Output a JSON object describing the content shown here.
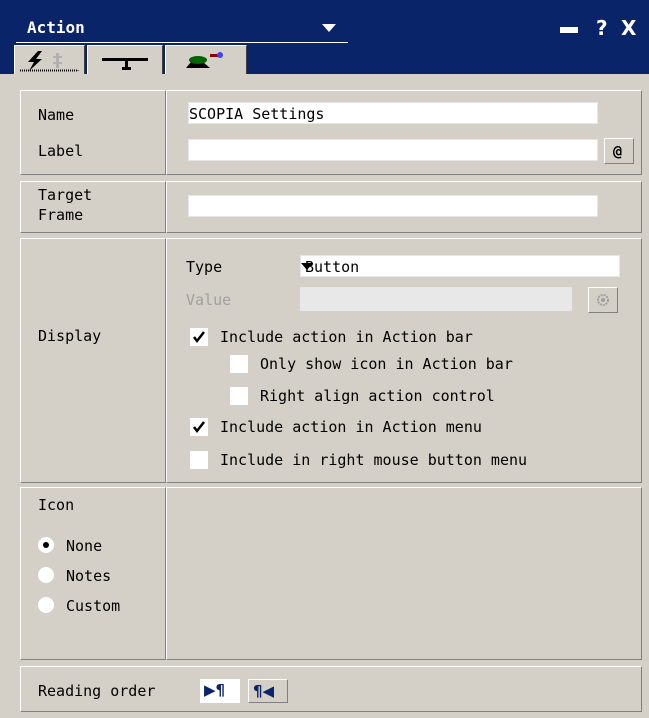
{
  "window": {
    "title": "Action",
    "help_glyph": "?",
    "close_glyph": "X"
  },
  "tabs": [
    {
      "name": "tab-basics",
      "icon": "lightning-icon"
    },
    {
      "name": "tab-options",
      "icon": "hammer-icon"
    },
    {
      "name": "tab-advanced",
      "icon": "propeller-hat-icon"
    }
  ],
  "fields": {
    "name_label": "Name",
    "name_value": "SCOPIA Settings",
    "label_label": "Label",
    "label_value": "",
    "at_button": "@",
    "target_frame_label_1": "Target",
    "target_frame_label_2": "Frame",
    "target_frame_value": ""
  },
  "display": {
    "section_label": "Display",
    "type_label": "Type",
    "type_value": "Button",
    "value_label": "Value",
    "options": [
      {
        "label": "Include action in Action bar",
        "checked": true
      },
      {
        "label": "Only show icon in Action bar",
        "checked": false
      },
      {
        "label": "Right align action control",
        "checked": false
      },
      {
        "label": "Include action in Action menu",
        "checked": true
      },
      {
        "label": "Include in right mouse button menu",
        "checked": false
      }
    ]
  },
  "icon": {
    "section_label": "Icon",
    "options": [
      {
        "label": "None",
        "selected": true
      },
      {
        "label": "Notes",
        "selected": false
      },
      {
        "label": "Custom",
        "selected": false
      }
    ]
  },
  "reading_order": {
    "label": "Reading order",
    "ltr_glyph": "▶¶",
    "rtl_glyph": "¶◀"
  },
  "colors": {
    "titlebar": "#0a246a",
    "face": "#d4d0c8"
  }
}
